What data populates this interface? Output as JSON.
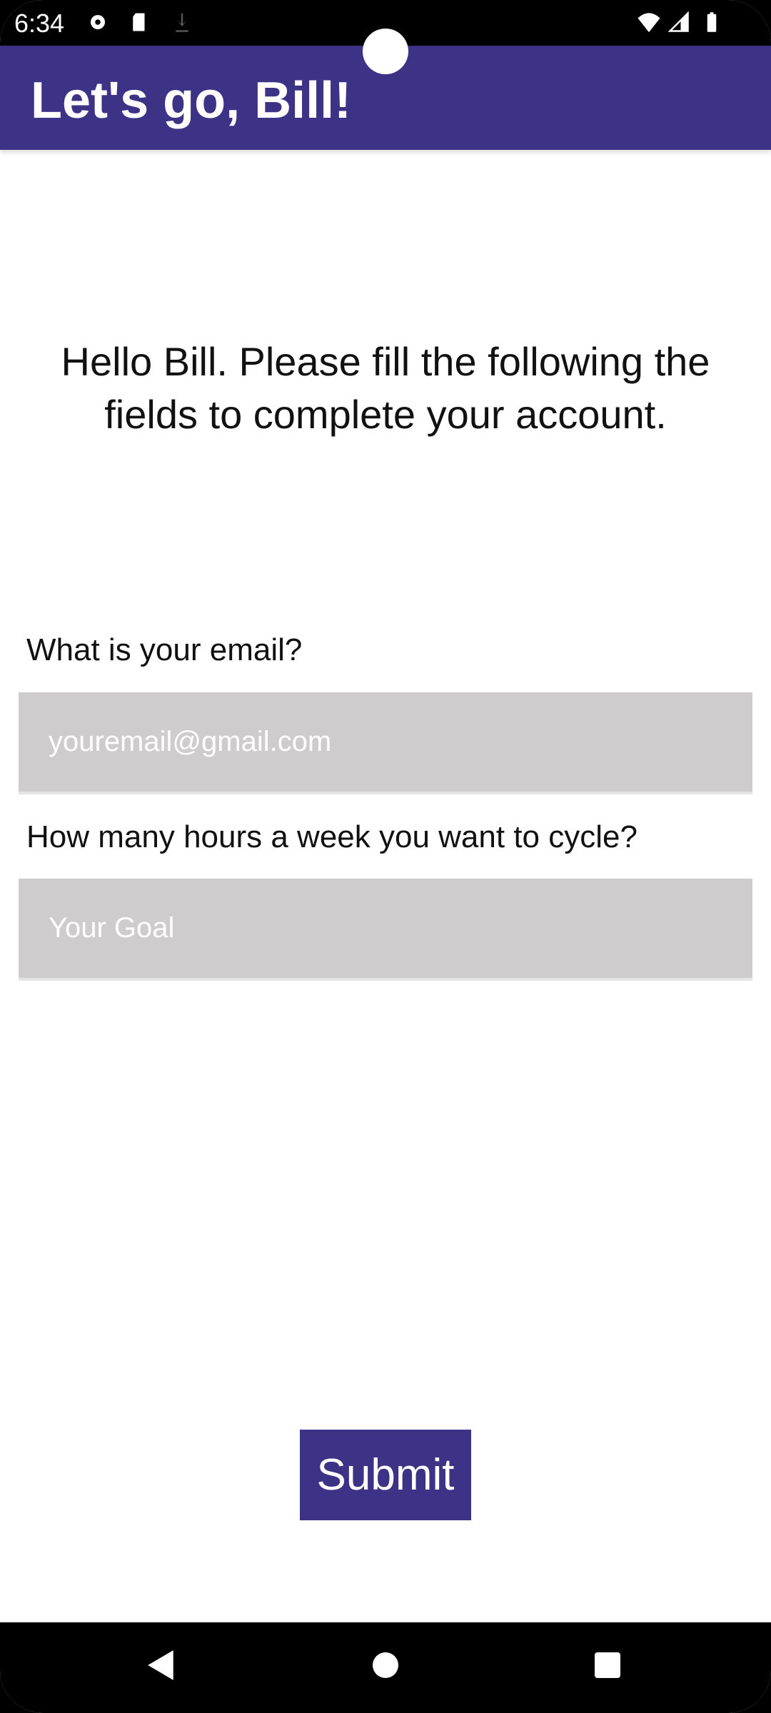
{
  "status_bar": {
    "time": "6:34",
    "icons": [
      "settings-icon",
      "sd-card-icon",
      "download-icon",
      "wifi-icon",
      "signal-icon",
      "battery-icon"
    ]
  },
  "app_bar": {
    "title": "Let's go, Bill!",
    "color": "#3c3386"
  },
  "intro": "Hello Bill. Please fill the following the fields to complete your account.",
  "form": {
    "email_label": "What is your email?",
    "email_placeholder": "youremail@gmail.com",
    "goal_label": "How many hours a week you want to cycle?",
    "goal_placeholder": "Your Goal",
    "submit_label": "Submit"
  },
  "nav_bar": {
    "icons": [
      "back-icon",
      "home-icon",
      "recents-icon"
    ]
  }
}
